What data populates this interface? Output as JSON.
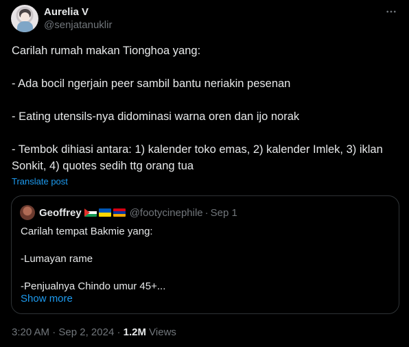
{
  "author": {
    "display_name": "Aurelia V",
    "handle": "@senjatanuklir"
  },
  "post": {
    "paragraphs": [
      "Carilah rumah makan Tionghoa yang:",
      "- Ada bocil ngerjain peer sambil bantu neriakin pesenan",
      "- Eating utensils-nya didominasi warna oren dan ijo norak",
      "- Tembok dihiasi antara: 1) kalender toko emas, 2) kalender Imlek, 3) iklan Sonkit, 4) quotes sedih ttg orang tua"
    ],
    "translate_label": "Translate post"
  },
  "quoted_post": {
    "display_name": "Geoffrey",
    "flags": [
      "palestine-flag",
      "ukraine-flag",
      "armenia-flag"
    ],
    "handle": "@footycinephile",
    "separator": "·",
    "date": "Sep 1",
    "paragraphs": [
      "Carilah tempat Bakmie yang:",
      "-Lumayan rame",
      "-Penjualnya Chindo umur 45+..."
    ],
    "show_more_label": "Show more"
  },
  "meta": {
    "time": "3:20 AM",
    "separator1": "·",
    "date": "Sep 2, 2024",
    "separator2": "·",
    "views_count": "1.2M",
    "views_label": "Views"
  },
  "colors": {
    "background": "#000000",
    "text": "#e7e9ea",
    "secondary": "#71767b",
    "link": "#1d9bf0",
    "border": "#2f3336"
  },
  "icons": {
    "more": "more-horizontal-icon"
  }
}
